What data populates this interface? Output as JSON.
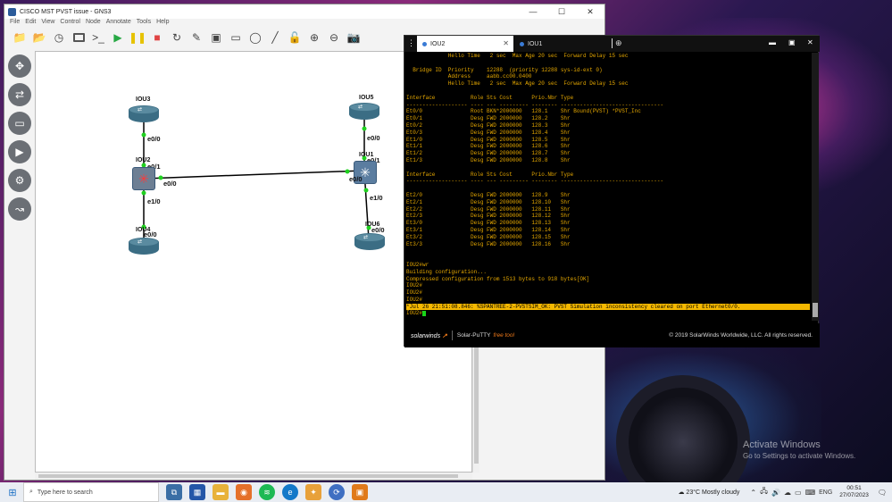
{
  "gns3": {
    "title": "CISCO MST PVST issue - GNS3",
    "menu": [
      "File",
      "Edit",
      "View",
      "Control",
      "Node",
      "Annotate",
      "Tools",
      "Help"
    ],
    "devices": {
      "iou3": "IOU3",
      "iou2": "IOU2",
      "iou4": "IOU4",
      "iou5": "IOU5",
      "iou1": "IOU1",
      "iou6": "IOU6"
    },
    "ports": {
      "iou3_e00": "e0/0",
      "iou2_e01": "e0/1",
      "iou2_e00": "e0/0",
      "iou2_e10": "e1/0",
      "iou4_e00": "e0/0",
      "iou5_e00": "e0/0",
      "iou1_e01": "e0/1",
      "iou1_e00": "e0/0",
      "iou1_e10": "e1/0",
      "iou6_e00": "e0/0"
    }
  },
  "terminal": {
    "tabs": [
      {
        "label": "IOU2",
        "active": true
      },
      {
        "label": "IOU1",
        "active": false
      }
    ],
    "lines": [
      "             Hello Time   2 sec  Max Age 20 sec  Forward Delay 15 sec",
      "",
      "  Bridge ID  Priority    12288  (priority 12288 sys-id-ext 0)",
      "             Address     aabb.cc00.0400",
      "             Hello Time   2 sec  Max Age 20 sec  Forward Delay 15 sec",
      "",
      "Interface           Role Sts Cost      Prio.Nbr Type",
      "------------------- ---- --- --------- -------- --------------------------------",
      "Et0/0               Root BKN*2000000   128.1    Shr Bound(PVST) *PVST_Inc",
      "Et0/1               Desg FWD 2000000   128.2    Shr",
      "Et0/2               Desg FWD 2000000   128.3    Shr",
      "Et0/3               Desg FWD 2000000   128.4    Shr",
      "Et1/0               Desg FWD 2000000   128.5    Shr",
      "Et1/1               Desg FWD 2000000   128.6    Shr",
      "Et1/2               Desg FWD 2000000   128.7    Shr",
      "Et1/3               Desg FWD 2000000   128.8    Shr",
      "",
      "Interface           Role Sts Cost      Prio.Nbr Type",
      "------------------- ---- --- --------- -------- --------------------------------",
      "",
      "Et2/0               Desg FWD 2000000   128.9    Shr",
      "Et2/1               Desg FWD 2000000   128.10   Shr",
      "Et2/2               Desg FWD 2000000   128.11   Shr",
      "Et2/3               Desg FWD 2000000   128.12   Shr",
      "Et3/0               Desg FWD 2000000   128.13   Shr",
      "Et3/1               Desg FWD 2000000   128.14   Shr",
      "Et3/2               Desg FWD 2000000   128.15   Shr",
      "Et3/3               Desg FWD 2000000   128.16   Shr",
      "",
      "",
      "IOU2#wr",
      "Building configuration...",
      "Compressed configuration from 1513 bytes to 918 bytes[OK]",
      "IOU2#",
      "IOU2#",
      "IOU2#",
      "*Jul 26 21:51:08.846: %SPANTREE-2-PVSTSIM_OK: PVST Simulation inconsistency cleared on port Ethernet0/0.",
      "IOU2#"
    ],
    "highlight_line": 36,
    "footer": {
      "brand": "solarwinds",
      "product": "Solar-PuTTY",
      "free": "free tool",
      "copyright": "© 2019 SolarWinds Worldwide, LLC. All rights reserved."
    }
  },
  "desktop": {
    "activate_title": "Activate Windows",
    "activate_sub": "Go to Settings to activate Windows."
  },
  "taskbar": {
    "search_placeholder": "Type here to search",
    "weather": "23°C  Mostly cloudy",
    "lang": "ENG",
    "time": "00:51",
    "date": "27/07/2023"
  },
  "colors": {
    "terminal_text": "#e6a800",
    "highlight_bg": "#f5b800",
    "link_green": "#1fd11f"
  }
}
